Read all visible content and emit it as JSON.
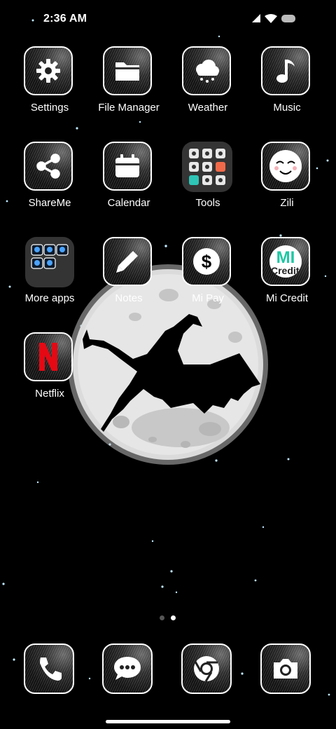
{
  "status": {
    "time": "2:36 AM"
  },
  "apps": [
    {
      "name": "settings",
      "label": "Settings",
      "icon": "gear-icon"
    },
    {
      "name": "file-manager",
      "label": "File Manager",
      "icon": "folder-icon"
    },
    {
      "name": "weather",
      "label": "Weather",
      "icon": "cloud-rain-icon"
    },
    {
      "name": "music",
      "label": "Music",
      "icon": "music-note-icon"
    },
    {
      "name": "shareme",
      "label": "ShareMe",
      "icon": "share-icon"
    },
    {
      "name": "calendar",
      "label": "Calendar",
      "icon": "calendar-icon"
    },
    {
      "name": "tools",
      "label": "Tools",
      "icon": "tools-folder-icon"
    },
    {
      "name": "zili",
      "label": "Zili",
      "icon": "smiley-face-icon"
    },
    {
      "name": "more-apps",
      "label": "More apps",
      "icon": "apps-folder-icon"
    },
    {
      "name": "notes",
      "label": "Notes",
      "icon": "pencil-icon"
    },
    {
      "name": "mi-pay",
      "label": "Mi Pay",
      "icon": "dollar-icon"
    },
    {
      "name": "mi-credit",
      "label": "Mi Credit",
      "icon": "mi-credit-logo-icon"
    },
    {
      "name": "netflix",
      "label": "Netflix",
      "icon": "netflix-logo-icon"
    }
  ],
  "mi_credit_logo_text": "MI",
  "mi_credit_logo_sub": "Credit",
  "dock": [
    {
      "name": "phone",
      "icon": "phone-icon"
    },
    {
      "name": "messages",
      "icon": "chat-bubble-icon"
    },
    {
      "name": "chrome",
      "icon": "chrome-icon"
    },
    {
      "name": "camera",
      "icon": "camera-icon"
    }
  ],
  "page_indicator": {
    "pages": 2,
    "current": 2
  },
  "colors": {
    "accent": "#ffffff",
    "background": "#000000",
    "netflix_red": "#e50914",
    "mi_credit_teal": "#1fc7a3"
  }
}
